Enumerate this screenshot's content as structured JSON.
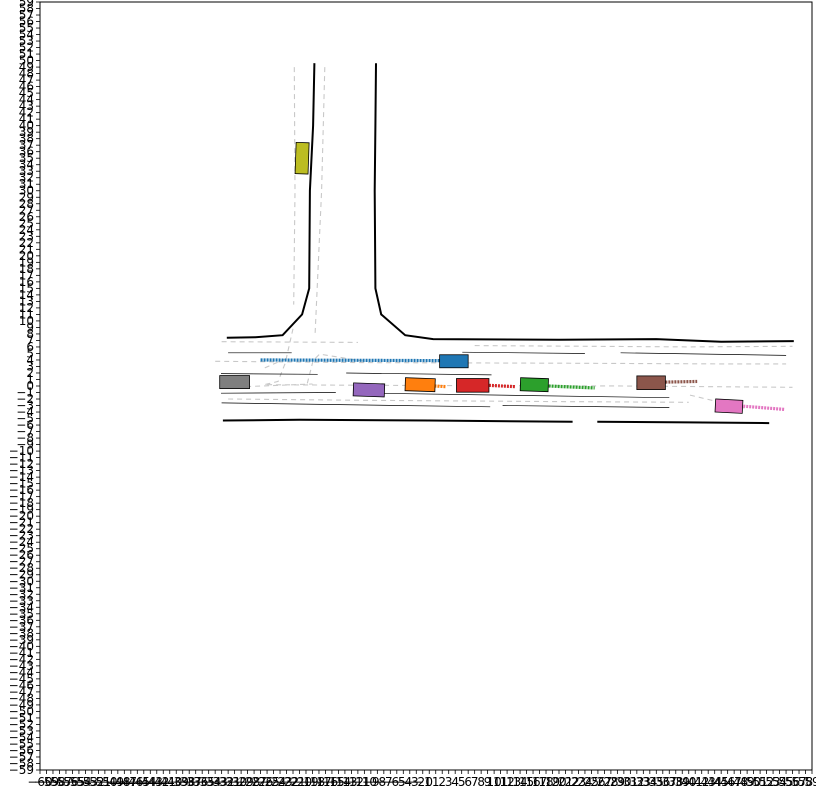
{
  "plot": {
    "x_range": [
      -60,
      59
    ],
    "y_range": [
      -59,
      59
    ],
    "tick_step": 1,
    "frame_color": "#000000",
    "x_tick_labels": [
      "-60",
      "-59",
      "-58",
      "-57",
      "-56",
      "-55",
      "-54",
      "-53",
      "-52",
      "-51",
      "-50",
      "-49",
      "-48",
      "-47",
      "-46",
      "-45",
      "-44",
      "-43",
      "-42",
      "-41",
      "-40",
      "-39",
      "-38",
      "-37",
      "-36",
      "-35",
      "-34",
      "-33",
      "-32",
      "-31",
      "-30",
      "-29",
      "-28",
      "-27",
      "-26",
      "-25",
      "-24",
      "-23",
      "-22",
      "-21",
      "-20",
      "-19",
      "-18",
      "-17",
      "-16",
      "-15",
      "-14",
      "-13",
      "-12",
      "-11",
      "-10",
      "-9",
      "-8",
      "-7",
      "-6",
      "-5",
      "-4",
      "-3",
      "-2",
      "-1",
      "0",
      "1",
      "2",
      "3",
      "4",
      "5",
      "6",
      "7",
      "8",
      "9",
      "10",
      "11",
      "12",
      "13",
      "14",
      "15",
      "16",
      "17",
      "18",
      "19",
      "20",
      "21",
      "22",
      "23",
      "24",
      "25",
      "26",
      "27",
      "28",
      "29",
      "30",
      "31",
      "32",
      "33",
      "34",
      "35",
      "36",
      "37",
      "38",
      "39",
      "40",
      "41",
      "42",
      "43",
      "44",
      "45",
      "46",
      "47",
      "48",
      "49",
      "50",
      "51",
      "52",
      "53",
      "54",
      "55",
      "56",
      "57",
      "58",
      "59"
    ],
    "y_tick_labels": [
      "-59",
      "-58",
      "-57",
      "-56",
      "-55",
      "-54",
      "-53",
      "-52",
      "-51",
      "-50",
      "-49",
      "-48",
      "-47",
      "-46",
      "-45",
      "-44",
      "-43",
      "-42",
      "-41",
      "-40",
      "-39",
      "-38",
      "-37",
      "-36",
      "-35",
      "-34",
      "-33",
      "-32",
      "-31",
      "-30",
      "-29",
      "-28",
      "-27",
      "-26",
      "-25",
      "-24",
      "-23",
      "-22",
      "-21",
      "-20",
      "-19",
      "-18",
      "-17",
      "-16",
      "-15",
      "-14",
      "-13",
      "-12",
      "-11",
      "-10",
      "-9",
      "-8",
      "-7",
      "-6",
      "-5",
      "-4",
      "-3",
      "-2",
      "-1",
      "0",
      "1",
      "2",
      "3",
      "4",
      "5",
      "6",
      "7",
      "8",
      "9",
      "10",
      "11",
      "12",
      "13",
      "14",
      "15",
      "16",
      "17",
      "18",
      "19",
      "20",
      "21",
      "22",
      "23",
      "24",
      "25",
      "26",
      "27",
      "28",
      "29",
      "30",
      "31",
      "32",
      "33",
      "34",
      "35",
      "36",
      "37",
      "38",
      "39",
      "40",
      "41",
      "42",
      "43",
      "44",
      "45",
      "46",
      "47",
      "48",
      "49",
      "50",
      "51",
      "52",
      "53",
      "54",
      "55",
      "56",
      "57",
      "58",
      "59"
    ]
  },
  "road_boundaries": {
    "color": "#000000",
    "lines": [
      [
        [
          -17.7,
          49.6
        ],
        [
          -17.9,
          40
        ],
        [
          -18.4,
          30
        ],
        [
          -18.5,
          15
        ],
        [
          -19.6,
          11
        ],
        [
          -22.6,
          7.8
        ],
        [
          -26.8,
          7.5
        ],
        [
          -31.2,
          7.4
        ]
      ],
      [
        [
          -8.2,
          49.6
        ],
        [
          -8.3,
          40
        ],
        [
          -8.4,
          30
        ],
        [
          -8.3,
          15
        ],
        [
          -7.4,
          11
        ],
        [
          -3.7,
          7.8
        ],
        [
          0.6,
          7.2
        ],
        [
          20,
          7.1
        ],
        [
          35,
          7.2
        ],
        [
          45,
          6.8
        ],
        [
          56.2,
          6.9
        ]
      ],
      [
        [
          -31.8,
          -5.3
        ],
        [
          -20,
          -5.2
        ],
        [
          0,
          -5.3
        ],
        [
          22.1,
          -5.5
        ]
      ],
      [
        [
          25.9,
          -5.5
        ],
        [
          40,
          -5.6
        ],
        [
          52.4,
          -5.7
        ]
      ]
    ]
  },
  "lane_lines": {
    "color": "#000000",
    "lines": [
      [
        [
          -31,
          5.1
        ],
        [
          -21.2,
          5.1
        ]
      ],
      [
        [
          -32.1,
          1.9
        ],
        [
          -17.2,
          1.8
        ]
      ],
      [
        [
          -32.1,
          -1.1
        ],
        [
          -14.4,
          -1.0
        ]
      ],
      [
        [
          -32,
          -2.6
        ],
        [
          9.4,
          -3.2
        ]
      ],
      [
        [
          -12.8,
          2.0
        ],
        [
          9.6,
          1.7
        ]
      ],
      [
        [
          -8.8,
          -1.1
        ],
        [
          37,
          -1.8
        ]
      ],
      [
        [
          5.1,
          5.2
        ],
        [
          24,
          5.0
        ]
      ],
      [
        [
          29.5,
          5.1
        ],
        [
          55,
          4.7
        ]
      ],
      [
        [
          11.3,
          -3.0
        ],
        [
          37,
          -3.3
        ]
      ]
    ]
  },
  "lane_centerlines": {
    "color": "#c8c8c8",
    "lines": [
      [
        [
          -20.8,
          49
        ],
        [
          -20.7,
          30
        ],
        [
          -20.9,
          12.5
        ]
      ],
      [
        [
          -16.1,
          49
        ],
        [
          -16.6,
          30
        ],
        [
          -17.6,
          8
        ]
      ],
      [
        [
          -32,
          6.8
        ],
        [
          -11,
          6.7
        ]
      ],
      [
        [
          7,
          6.2
        ],
        [
          40,
          6.0
        ],
        [
          56,
          6.1
        ]
      ],
      [
        [
          -33,
          3.8
        ],
        [
          -10,
          3.6
        ],
        [
          20,
          3.5
        ],
        [
          45,
          3.4
        ],
        [
          55,
          3.4
        ]
      ],
      [
        [
          -31,
          -0.2
        ],
        [
          -18,
          0.3
        ]
      ],
      [
        [
          -25,
          0.2
        ],
        [
          -10,
          0.1
        ],
        [
          30,
          0.0
        ],
        [
          56,
          -0.2
        ]
      ],
      [
        [
          -31,
          -2.0
        ],
        [
          -10,
          -2.2
        ],
        [
          20,
          -2.4
        ],
        [
          40,
          -2.5
        ]
      ],
      [
        [
          -18.8,
          0.4
        ],
        [
          -17.9,
          3.9
        ],
        [
          -16.9,
          4.9
        ],
        [
          -10,
          3.8
        ]
      ],
      [
        [
          -21,
          8.8
        ],
        [
          -22.2,
          3.5
        ],
        [
          -23.3,
          0.7
        ],
        [
          -25.8,
          0.1
        ]
      ],
      [
        [
          -22.1,
          4.2
        ],
        [
          -25.8,
          2.6
        ]
      ],
      [
        [
          40.2,
          -1.4
        ],
        [
          48.6,
          -3.4
        ]
      ]
    ]
  },
  "vehicles": [
    {
      "id": "blue",
      "color": "#1f77b4",
      "cx": 3.8,
      "cy": 3.8,
      "w": 4.4,
      "h": 2.0,
      "angle": 0,
      "trail": {
        "from": [
          -26,
          4.0
        ],
        "to": [
          1.6,
          3.9
        ]
      }
    },
    {
      "id": "olive",
      "color": "#bcbd22",
      "cx": -19.6,
      "cy": 35.0,
      "w": 2.0,
      "h": 4.8,
      "angle": -2,
      "trail": null
    },
    {
      "id": "grey",
      "color": "#7f7f7f",
      "cx": -30.0,
      "cy": 0.6,
      "w": 4.6,
      "h": 2.0,
      "angle": 0,
      "trail": null
    },
    {
      "id": "purple",
      "color": "#9467bd",
      "cx": -9.3,
      "cy": -0.6,
      "w": 4.8,
      "h": 2.0,
      "angle": -2,
      "trail": null
    },
    {
      "id": "orange",
      "color": "#ff7f0e",
      "cx": -1.4,
      "cy": 0.2,
      "w": 4.6,
      "h": 2.0,
      "angle": -2,
      "trail": {
        "from": [
          0.8,
          0.0
        ],
        "to": [
          2.6,
          -0.1
        ]
      }
    },
    {
      "id": "red",
      "color": "#d62728",
      "cx": 6.7,
      "cy": 0.1,
      "w": 5.0,
      "h": 2.1,
      "angle": 0,
      "trail": {
        "from": [
          9.2,
          0.1
        ],
        "to": [
          13.2,
          -0.1
        ]
      }
    },
    {
      "id": "green",
      "color": "#2ca02c",
      "cx": 16.2,
      "cy": 0.2,
      "w": 4.3,
      "h": 2.0,
      "angle": -2,
      "trail": {
        "from": [
          18.4,
          0.0
        ],
        "to": [
          25.5,
          -0.3
        ]
      }
    },
    {
      "id": "brown",
      "color": "#8c564b",
      "cx": 34.2,
      "cy": 0.5,
      "w": 4.4,
      "h": 2.1,
      "angle": 0,
      "trail": {
        "from": [
          36.4,
          0.6
        ],
        "to": [
          41.3,
          0.7
        ]
      }
    },
    {
      "id": "pink",
      "color": "#e377c2",
      "cx": 46.2,
      "cy": -3.1,
      "w": 4.2,
      "h": 2.0,
      "angle": -3,
      "trail": {
        "from": [
          48.4,
          -3.1
        ],
        "to": [
          54.8,
          -3.6
        ]
      }
    }
  ]
}
